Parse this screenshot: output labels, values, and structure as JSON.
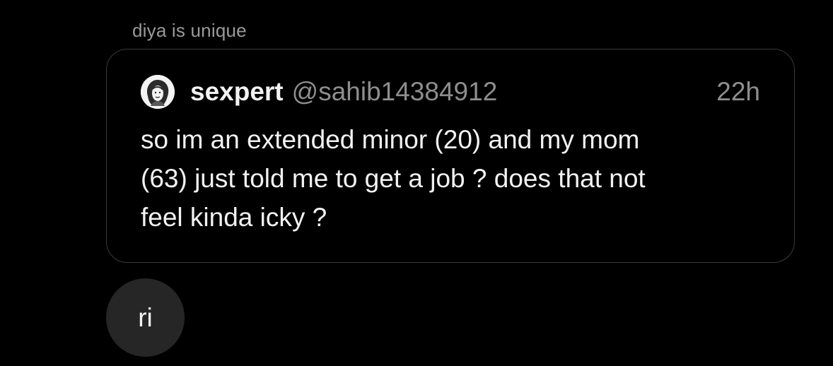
{
  "thread": {
    "sender_label": "diya is unique"
  },
  "quoted_post": {
    "avatar": "avatar-illustration",
    "username": "sexpert",
    "handle": "@sahib14384912",
    "timestamp": "22h",
    "lines": [
      "so im an extended minor (20) and my mom",
      "(63) just told me to get a job ? does that not",
      "feel kinda icky ?"
    ]
  },
  "reply": {
    "text": "ri"
  },
  "colors": {
    "background": "#000000",
    "card_border": "#3a3a3a",
    "muted_text": "#8e8e8e",
    "bubble": "#262626"
  }
}
